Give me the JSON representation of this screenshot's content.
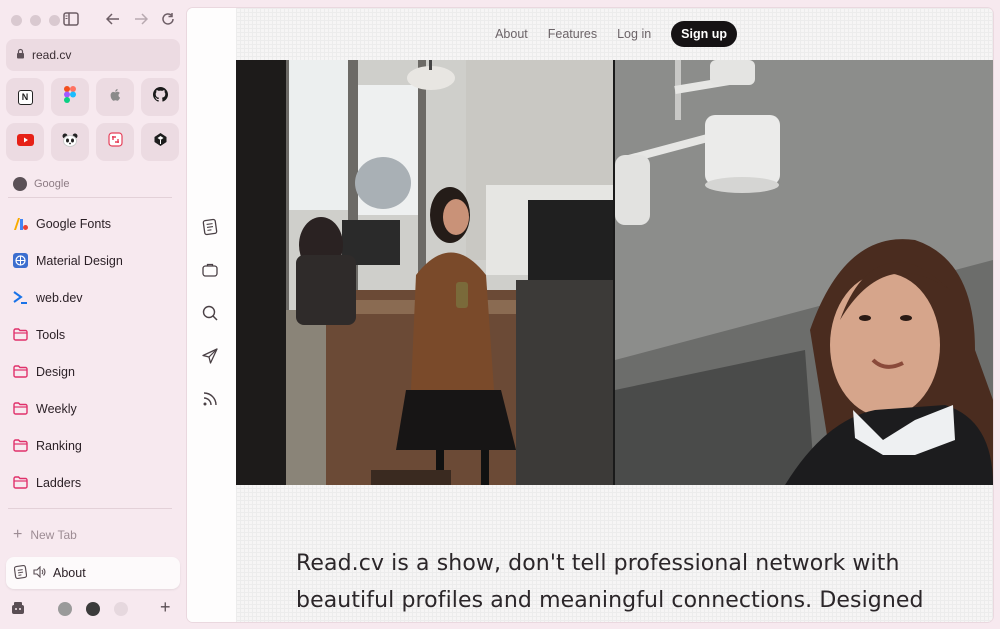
{
  "browser": {
    "url": "read.cv",
    "favorites": [
      {
        "name": "notion-icon"
      },
      {
        "name": "figma-icon"
      },
      {
        "name": "apple-icon"
      },
      {
        "name": "github-icon"
      },
      {
        "name": "youtube-icon"
      },
      {
        "name": "panda-icon"
      },
      {
        "name": "craft-icon"
      },
      {
        "name": "codepen-icon"
      }
    ],
    "section_label": "Google",
    "nav_items": [
      {
        "label": "Google Fonts",
        "icon": "google-fonts-icon"
      },
      {
        "label": "Material Design",
        "icon": "material-design-icon"
      },
      {
        "label": "web.dev",
        "icon": "web-dev-icon"
      },
      {
        "label": "Tools",
        "icon": "folder-icon"
      },
      {
        "label": "Design",
        "icon": "folder-icon"
      },
      {
        "label": "Weekly",
        "icon": "folder-icon"
      },
      {
        "label": "Ranking",
        "icon": "folder-icon"
      },
      {
        "label": "Ladders",
        "icon": "folder-icon"
      }
    ],
    "new_tab_label": "New Tab",
    "active_tab": {
      "label": "About"
    }
  },
  "site": {
    "nav": {
      "about": "About",
      "features": "Features",
      "login": "Log in",
      "signup": "Sign up"
    },
    "tagline": "Read.cv is a show, don't tell professional network with beautiful profiles and meaningful connections. Designed"
  },
  "colors": {
    "accent_pink": "#e0306a",
    "sidebar_bg": "#f7e9ef",
    "signup_bg": "#151214"
  }
}
